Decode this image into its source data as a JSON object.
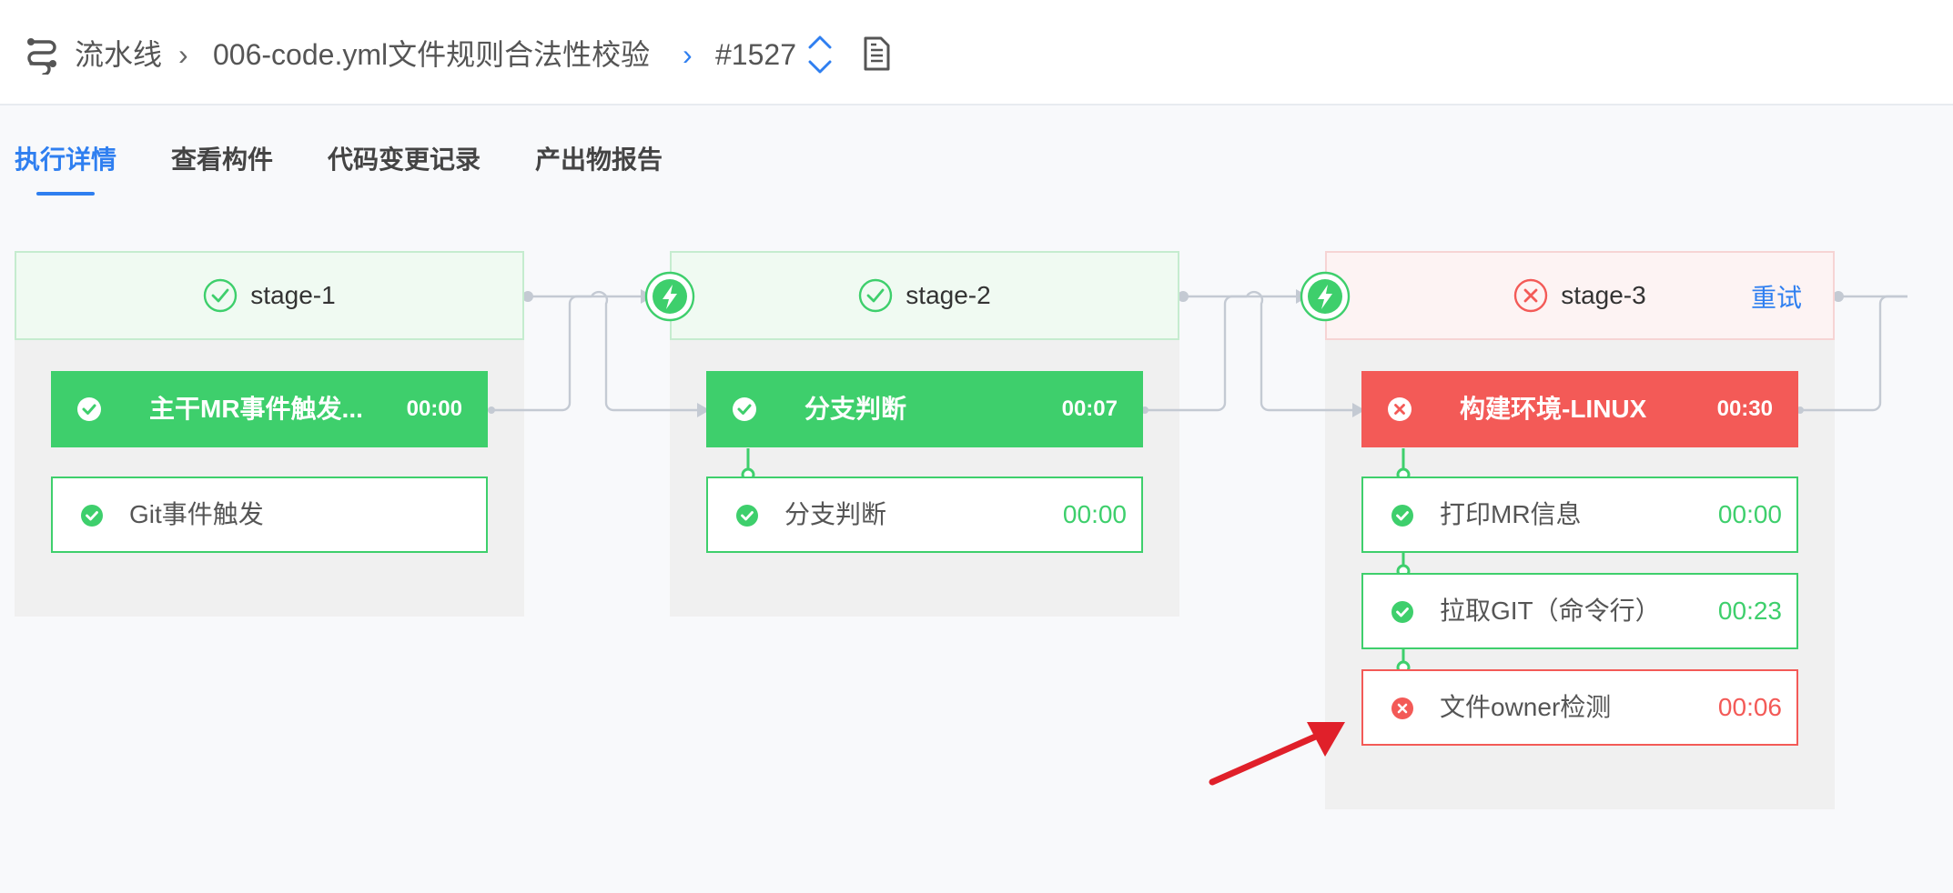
{
  "breadcrumb": {
    "root": "流水线",
    "pipeline": "006-code.yml文件规则合法性校验",
    "build": "#1527",
    "sep1": "›",
    "sep2": "›"
  },
  "tabs": [
    {
      "label": "执行详情",
      "active": true
    },
    {
      "label": "查看构件",
      "active": false
    },
    {
      "label": "代码变更记录",
      "active": false
    },
    {
      "label": "产出物报告",
      "active": false
    }
  ],
  "stages": [
    {
      "name": "stage-1",
      "status": "success",
      "jobs": [
        {
          "name": "主干MR事件触发...",
          "time": "00:00",
          "status": "success",
          "steps": [
            {
              "name": "Git事件触发",
              "time": "",
              "status": "success"
            }
          ]
        }
      ]
    },
    {
      "name": "stage-2",
      "status": "success",
      "jobs": [
        {
          "name": "分支判断",
          "time": "00:07",
          "status": "success",
          "steps": [
            {
              "name": "分支判断",
              "time": "00:00",
              "status": "success"
            }
          ]
        }
      ]
    },
    {
      "name": "stage-3",
      "status": "failed",
      "retry_label": "重试",
      "jobs": [
        {
          "name": "构建环境-LINUX",
          "time": "00:30",
          "status": "failed",
          "steps": [
            {
              "name": "打印MR信息",
              "time": "00:00",
              "status": "success"
            },
            {
              "name": "拉取GIT（命令行）",
              "time": "00:23",
              "status": "success"
            },
            {
              "name": "文件owner检测",
              "time": "00:06",
              "status": "failed"
            }
          ]
        }
      ]
    }
  ],
  "colors": {
    "accent": "#2f7ff0",
    "success": "#3ecf6c",
    "failed": "#f35a57",
    "annotation_arrow": "#e0202a"
  },
  "icons": {
    "pipeline": "pipeline-icon",
    "updown": "chevron-updown-icon",
    "log": "document-icon",
    "trigger": "lightning-icon"
  }
}
